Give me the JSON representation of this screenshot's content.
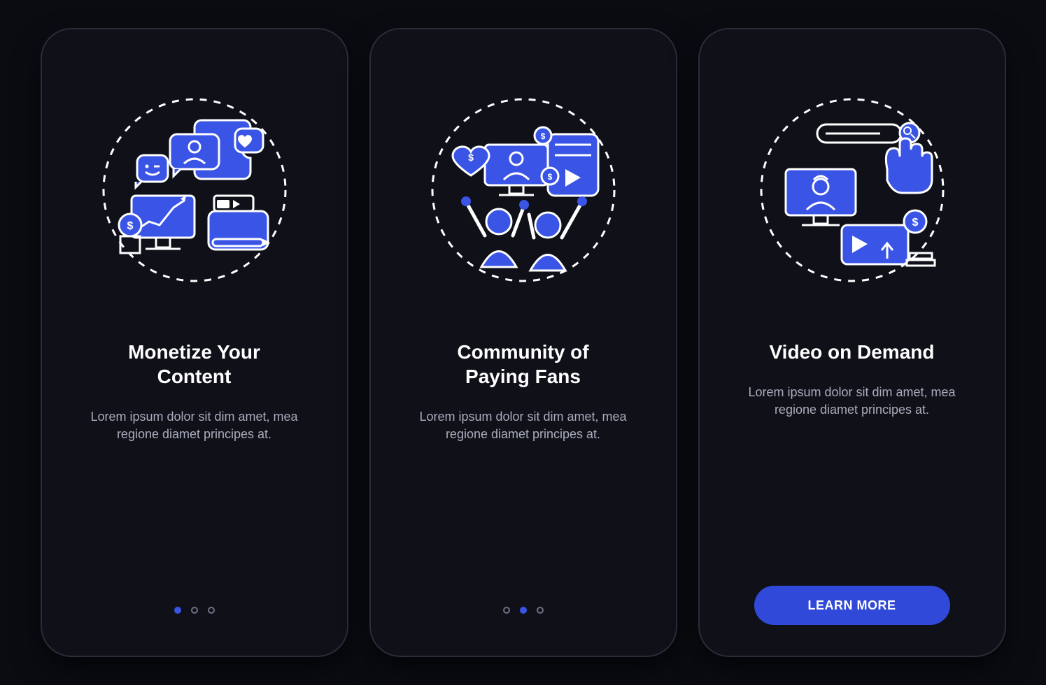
{
  "accent": "#3a55e6",
  "screens": [
    {
      "icon": "monetize-content-icon",
      "title": "Monetize Your\nContent",
      "body": "Lorem ipsum dolor sit dim amet, mea regione diamet principes at.",
      "active_dot": 0
    },
    {
      "icon": "community-fans-icon",
      "title": "Community of\nPaying Fans",
      "body": "Lorem ipsum dolor sit dim amet, mea regione diamet principes at.",
      "active_dot": 1
    },
    {
      "icon": "video-on-demand-icon",
      "title": "Video on Demand",
      "body": "Lorem ipsum dolor sit dim amet, mea regione diamet principes at.",
      "cta_label": "LEARN MORE"
    }
  ]
}
